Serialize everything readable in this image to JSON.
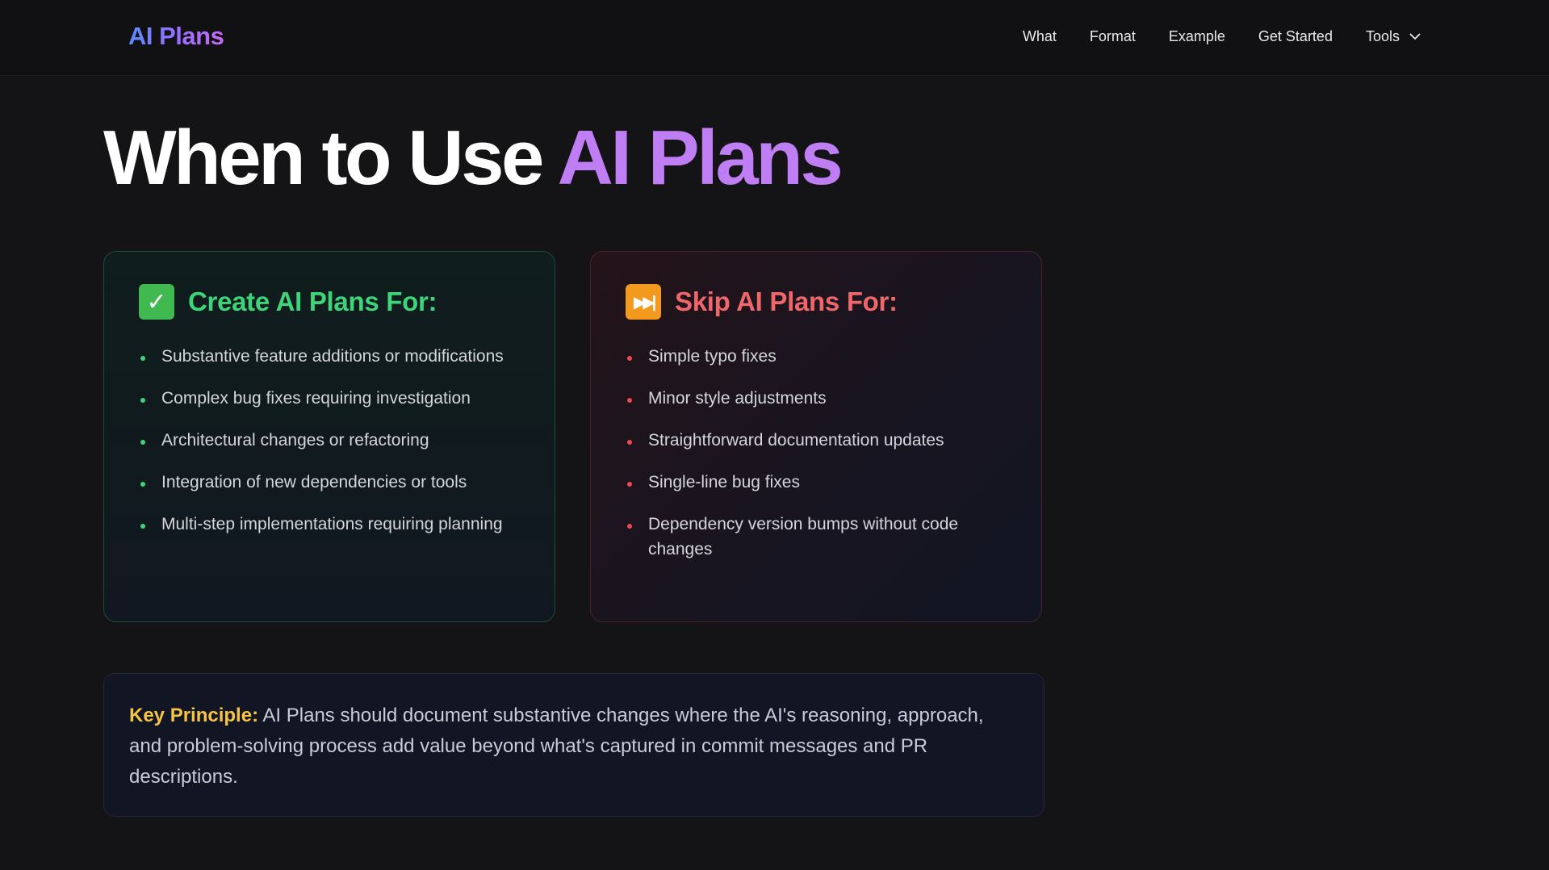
{
  "header": {
    "brand": "AI Plans",
    "nav": [
      "What",
      "Format",
      "Example",
      "Get Started"
    ],
    "tools_label": "Tools"
  },
  "hero": {
    "title_plain": "When to Use ",
    "title_accent": "AI Plans"
  },
  "create_card": {
    "icon": "check-mark-emoji",
    "title": "Create AI Plans For:",
    "items": [
      "Substantive feature additions or modifications",
      "Complex bug fixes requiring investigation",
      "Architectural changes or refactoring",
      "Integration of new dependencies or tools",
      "Multi-step implementations requiring planning"
    ]
  },
  "skip_card": {
    "icon": "fast-forward-emoji",
    "title": "Skip AI Plans For:",
    "items": [
      "Simple typo fixes",
      "Minor style adjustments",
      "Straightforward documentation updates",
      "Single-line bug fixes",
      "Dependency version bumps without code changes"
    ]
  },
  "principle": {
    "label": "Key Principle:",
    "text": " AI Plans should document substantive changes where the AI's reasoning, approach, and problem-solving process add value beyond what's captured in commit messages and PR descriptions."
  },
  "colors": {
    "background": "#141416",
    "brand_gradient_start": "#5b8cff",
    "brand_gradient_end": "#c66cf5",
    "accent_purple": "#c07ef5",
    "create_green": "#3ed47a",
    "skip_red": "#f0676b",
    "principle_yellow": "#f6c445"
  }
}
